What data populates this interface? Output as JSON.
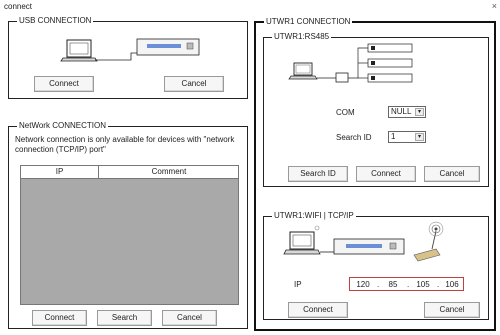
{
  "window": {
    "title": "connect",
    "close_glyph": "×"
  },
  "usb": {
    "legend": "USB CONNECTION",
    "connect_label": "Connect",
    "cancel_label": "Cancel"
  },
  "network": {
    "legend": "NetWork CONNECTION",
    "note": "Network connection is only available for devices with \"network connection (TCP/IP) port\"",
    "columns": [
      "IP",
      "Comment"
    ],
    "connect_label": "Connect",
    "search_label": "Search",
    "cancel_label": "Cancel"
  },
  "utwr1": {
    "legend": "UTWR1 CONNECTION",
    "rs485": {
      "legend": "UTWR1:RS485",
      "com_label": "COM",
      "com_value": "NULL",
      "search_id_label": "Search ID",
      "search_id_value": "1",
      "search_id_button": "Search ID",
      "connect_label": "Connect",
      "cancel_label": "Cancel"
    },
    "wifi": {
      "legend": "UTWR1:WIFI  |  TCP/IP",
      "ip_label": "IP",
      "ip": [
        "120",
        "85",
        "105",
        "106"
      ],
      "ip_dots": [
        ".",
        ".",
        "."
      ],
      "connect_label": "Connect",
      "cancel_label": "Cancel"
    }
  },
  "icons": {
    "laptop": "laptop-icon",
    "device": "rack-device-icon",
    "converter": "converter-icon",
    "antenna": "wifi-antenna-icon"
  }
}
